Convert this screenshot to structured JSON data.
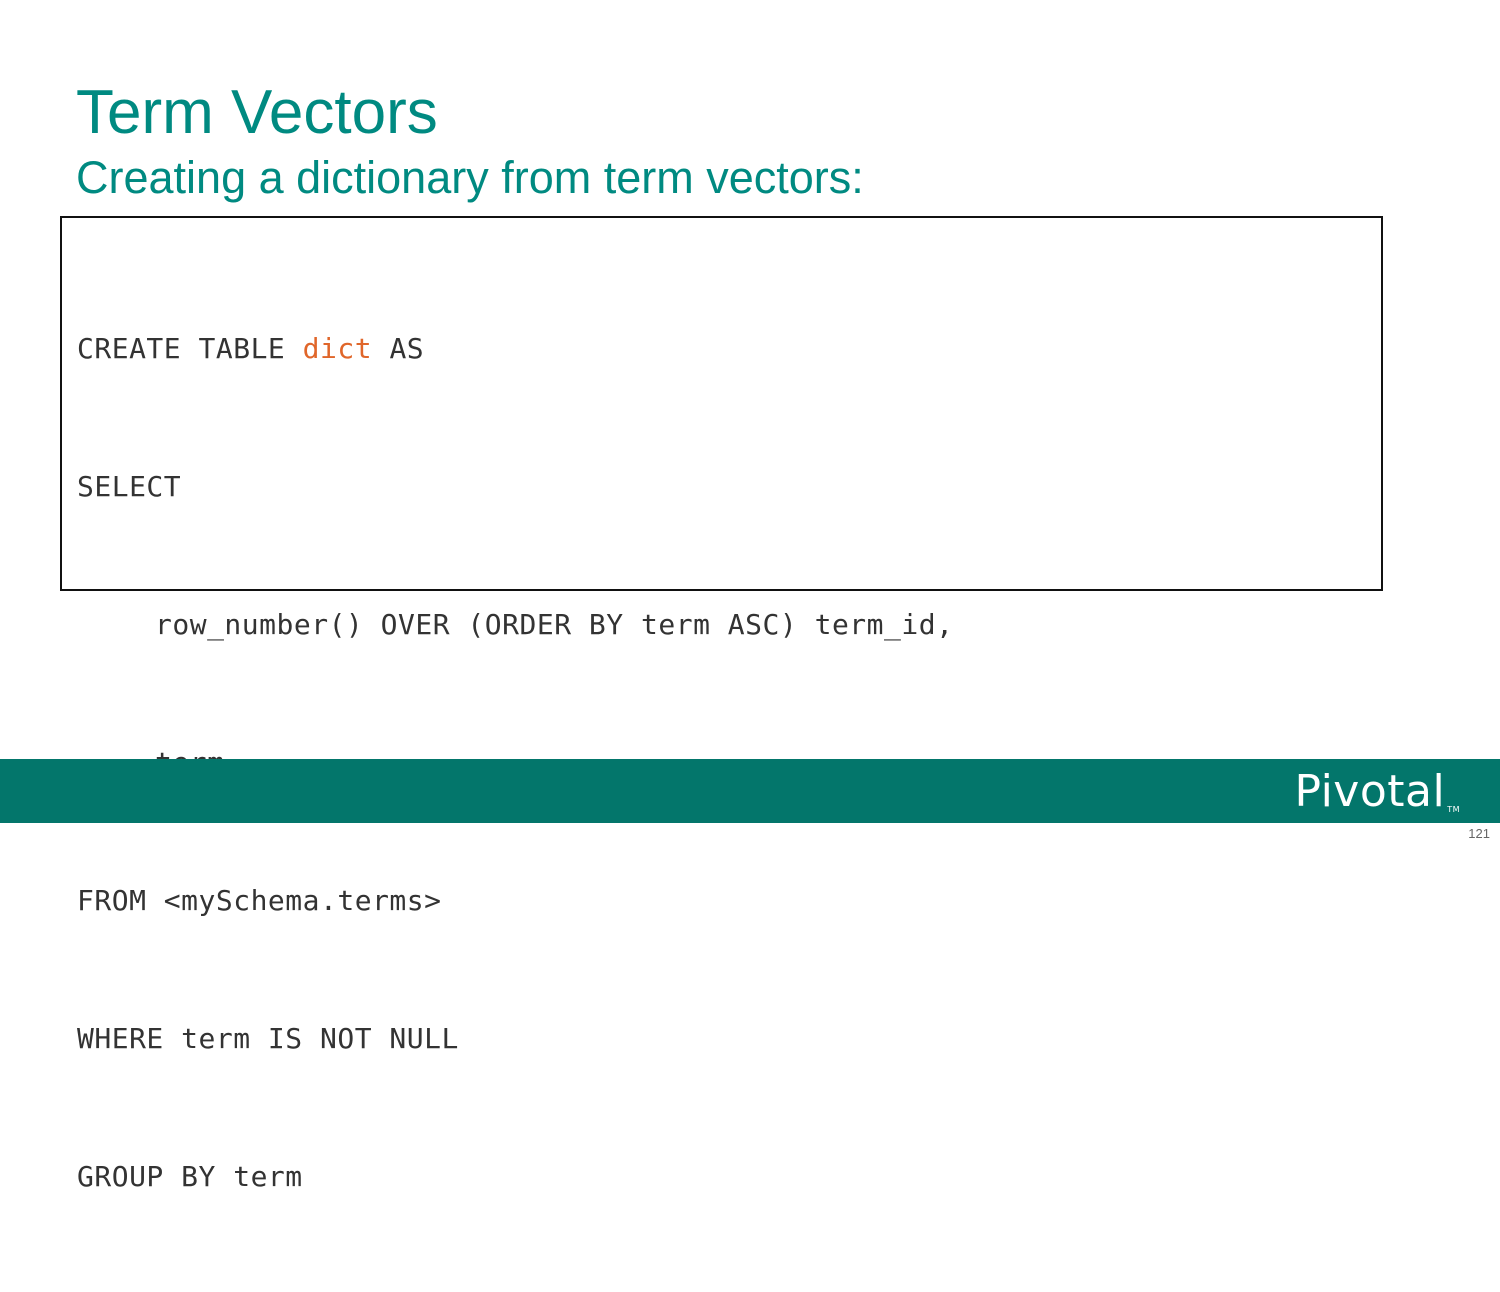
{
  "slide": {
    "title": "Term Vectors",
    "subtitle": "Creating a dictionary from term vectors:",
    "page_number": "121"
  },
  "code": {
    "line1_pre": "CREATE TABLE ",
    "line1_highlight": "dict",
    "line1_post": " AS",
    "line2": "SELECT",
    "line3": "row_number() OVER (ORDER BY term ASC) term_id,",
    "line4": "term,",
    "line5": "FROM <mySchema.terms>",
    "line6": "WHERE term IS NOT NULL",
    "line7": "GROUP BY term"
  },
  "footer": {
    "logo_text": "Pivotal",
    "logo_tm": "TM",
    "bar_color": "#03766b"
  },
  "colors": {
    "title": "#008a81",
    "highlight": "#e0662a"
  }
}
